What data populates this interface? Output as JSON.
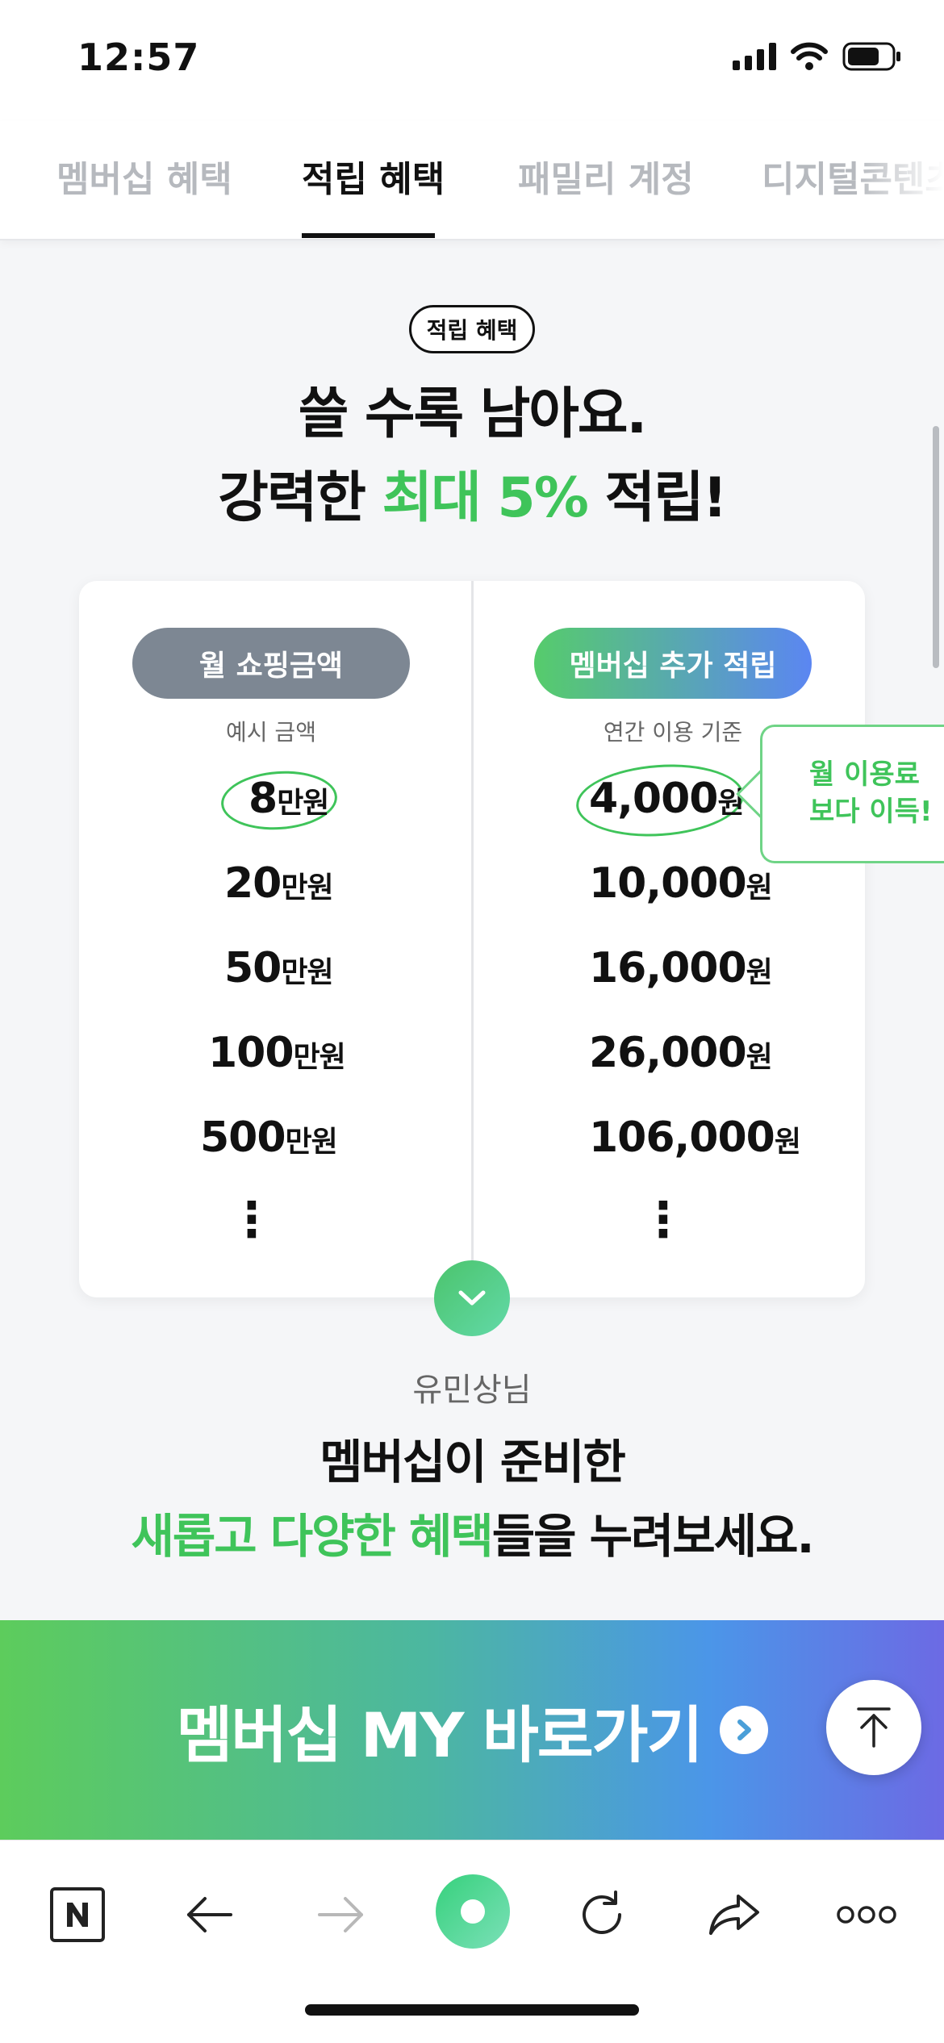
{
  "status_bar": {
    "time": "12:57"
  },
  "tabs": [
    {
      "label": "멤버십 혜택",
      "active": false
    },
    {
      "label": "적립 혜택",
      "active": true
    },
    {
      "label": "패밀리 계정",
      "active": false
    },
    {
      "label": "디지털콘텐츠",
      "active": false
    }
  ],
  "section": {
    "badge": "적립 혜택",
    "headline_line1": "쓸 수록 남아요.",
    "headline_line2_pre": "강력한 ",
    "headline_line2_highlight": "최대 5%",
    "headline_line2_post": " 적립!"
  },
  "card": {
    "left_header": "월 쇼핑금액",
    "left_sub": "예시 금액",
    "right_header": "멤버십 추가 적립",
    "right_sub": "연간 이용 기준",
    "left_unit": "만원",
    "right_unit": "원",
    "rows": [
      {
        "shopping": "8",
        "reward": "4,000",
        "highlight": true
      },
      {
        "shopping": "20",
        "reward": "10,000",
        "highlight": false
      },
      {
        "shopping": "50",
        "reward": "16,000",
        "highlight": false
      },
      {
        "shopping": "100",
        "reward": "26,000",
        "highlight": false
      },
      {
        "shopping": "500",
        "reward": "106,000",
        "highlight": false
      }
    ],
    "more": "⋮"
  },
  "callout": {
    "line1": "월 이용료",
    "line2": "보다 이득!"
  },
  "promo": {
    "user": "유민상님",
    "line1": "멤버십이 준비한",
    "line2_highlight": "새롭고 다양한 혜택",
    "line2_post": "들을 누려보세요."
  },
  "cta": {
    "label": "멤버십 MY 바로가기"
  },
  "colors": {
    "accent_green": "#3fc45a",
    "pill_gray": "#7d8793",
    "gradient_blue": "#5b86f2"
  },
  "icons": [
    "signal-icon",
    "wifi-icon",
    "battery-icon",
    "chevron-down-icon",
    "chevron-right-icon",
    "arrow-up-icon",
    "naver-icon",
    "back-icon",
    "forward-icon",
    "green-dot-icon",
    "refresh-icon",
    "share-icon",
    "more-icon"
  ]
}
